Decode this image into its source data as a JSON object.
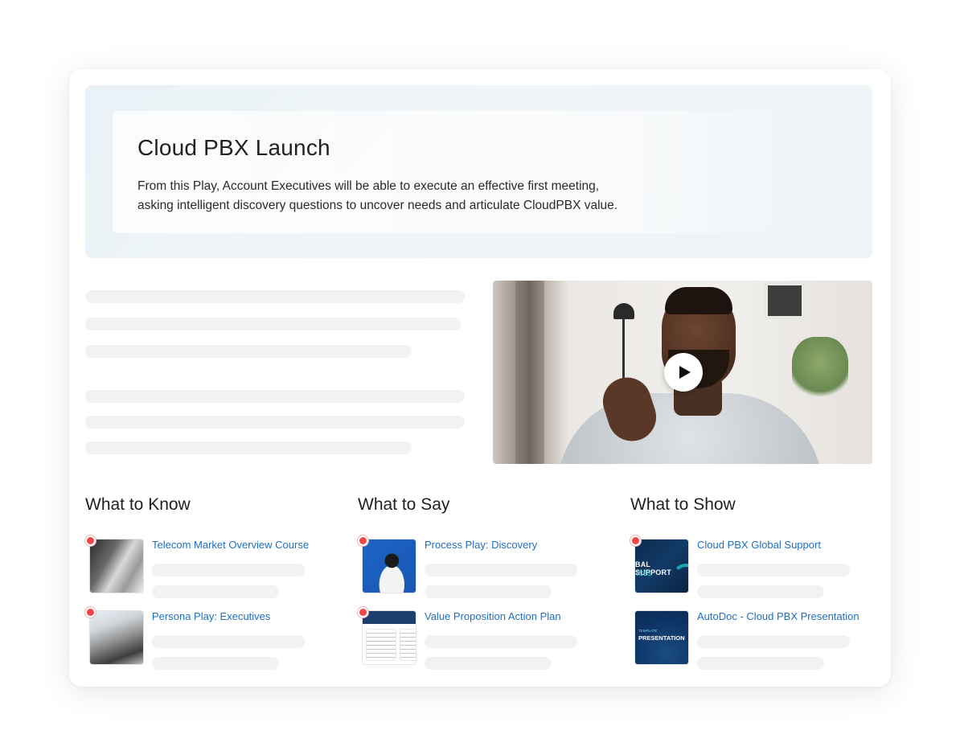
{
  "hero": {
    "title": "Cloud PBX Launch",
    "description": "From this Play, Account Executives will be able to execute an effective first meeting, asking intelligent discovery questions to uncover needs and articulate CloudPBX value."
  },
  "video": {
    "play_icon": "play-icon"
  },
  "columns": [
    {
      "title": "What to Know",
      "items": [
        {
          "label": "Telecom Market Overview Course",
          "new": true,
          "thumb": "bw-photo-two-women"
        },
        {
          "label": "Persona Play: Executives",
          "new": true,
          "thumb": "bw-photo-man-woman-tablet"
        }
      ]
    },
    {
      "title": "What to Say",
      "items": [
        {
          "label": "Process Play: Discovery",
          "new": true,
          "thumb": "woman-on-blue"
        },
        {
          "label": "Value Proposition Action Plan",
          "new": true,
          "thumb": "document-preview"
        }
      ]
    },
    {
      "title": "What to Show",
      "items": [
        {
          "label": "Cloud PBX Global Support",
          "new": true,
          "thumb": "global-support-slide",
          "thumb_text_1": "BAL SUPPORT",
          "thumb_text_2": "ICES"
        },
        {
          "label": "AutoDoc - Cloud PBX Presentation",
          "new": false,
          "thumb": "presentation-template",
          "thumb_text_1": "TEMPLATE",
          "thumb_text_2": "PRESENTATION"
        }
      ]
    }
  ],
  "colors": {
    "link": "#1f6fc0",
    "new_dot": "#f04848",
    "skeleton": "#f2f2f2"
  }
}
